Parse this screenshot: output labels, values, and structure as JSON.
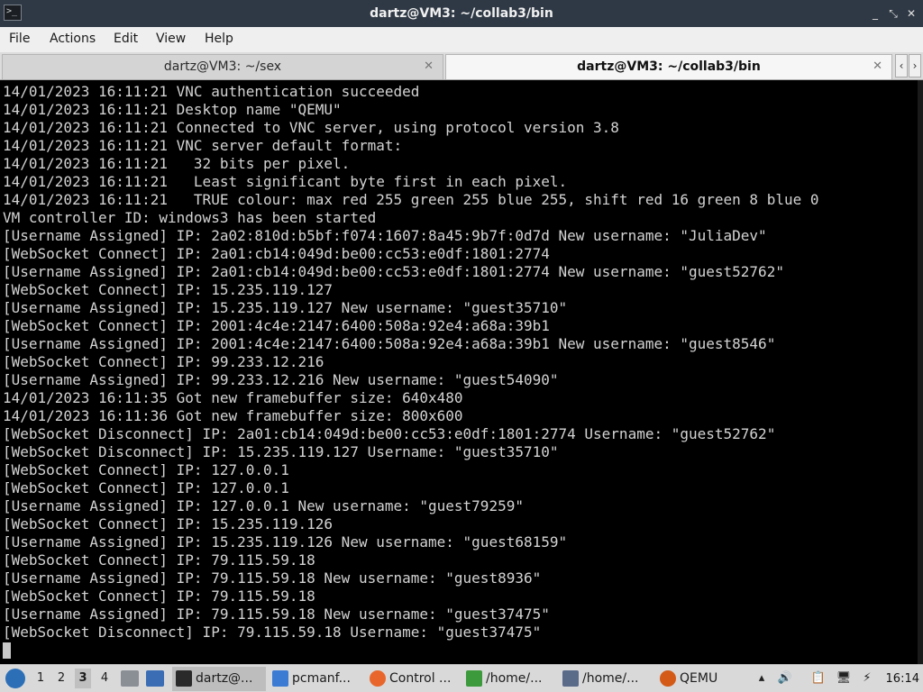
{
  "window": {
    "title": "dartz@VM3: ~/collab3/bin",
    "controls": {
      "minimize": "_",
      "maximize": "⤡",
      "close": "✕"
    }
  },
  "menu": [
    "File",
    "Actions",
    "Edit",
    "View",
    "Help"
  ],
  "tabs": [
    {
      "label": "dartz@VM3: ~/sex",
      "active": false
    },
    {
      "label": "dartz@VM3: ~/collab3/bin",
      "active": true
    }
  ],
  "tab_nav": {
    "left": "‹",
    "right": "›"
  },
  "terminal": {
    "lines": [
      "14/01/2023 16:11:21 VNC authentication succeeded",
      "14/01/2023 16:11:21 Desktop name \"QEMU\"",
      "14/01/2023 16:11:21 Connected to VNC server, using protocol version 3.8",
      "14/01/2023 16:11:21 VNC server default format:",
      "14/01/2023 16:11:21   32 bits per pixel.",
      "14/01/2023 16:11:21   Least significant byte first in each pixel.",
      "14/01/2023 16:11:21   TRUE colour: max red 255 green 255 blue 255, shift red 16 green 8 blue 0",
      "VM controller ID: windows3 has been started",
      "[Username Assigned] IP: 2a02:810d:b5bf:f074:1607:8a45:9b7f:0d7d New username: \"JuliaDev\"",
      "[WebSocket Connect] IP: 2a01:cb14:049d:be00:cc53:e0df:1801:2774",
      "[Username Assigned] IP: 2a01:cb14:049d:be00:cc53:e0df:1801:2774 New username: \"guest52762\"",
      "[WebSocket Connect] IP: 15.235.119.127",
      "[Username Assigned] IP: 15.235.119.127 New username: \"guest35710\"",
      "[WebSocket Connect] IP: 2001:4c4e:2147:6400:508a:92e4:a68a:39b1",
      "[Username Assigned] IP: 2001:4c4e:2147:6400:508a:92e4:a68a:39b1 New username: \"guest8546\"",
      "[WebSocket Connect] IP: 99.233.12.216",
      "[Username Assigned] IP: 99.233.12.216 New username: \"guest54090\"",
      "14/01/2023 16:11:35 Got new framebuffer size: 640x480",
      "14/01/2023 16:11:36 Got new framebuffer size: 800x600",
      "[WebSocket Disconnect] IP: 2a01:cb14:049d:be00:cc53:e0df:1801:2774 Username: \"guest52762\"",
      "[WebSocket Disconnect] IP: 15.235.119.127 Username: \"guest35710\"",
      "[WebSocket Connect] IP: 127.0.0.1",
      "[WebSocket Connect] IP: 127.0.0.1",
      "[Username Assigned] IP: 127.0.0.1 New username: \"guest79259\"",
      "[WebSocket Connect] IP: 15.235.119.126",
      "[Username Assigned] IP: 15.235.119.126 New username: \"guest68159\"",
      "[WebSocket Connect] IP: 79.115.59.18",
      "[Username Assigned] IP: 79.115.59.18 New username: \"guest8936\"",
      "[WebSocket Connect] IP: 79.115.59.18",
      "[Username Assigned] IP: 79.115.59.18 New username: \"guest37475\"",
      "[WebSocket Disconnect] IP: 79.115.59.18 Username: \"guest37475\""
    ]
  },
  "taskbar": {
    "workspaces": [
      "1",
      "2",
      "3",
      "4"
    ],
    "active_workspace": "3",
    "tasks": [
      {
        "label": "dartz@...",
        "icon": "terminal-icon",
        "active": true
      },
      {
        "label": "pcmanf...",
        "icon": "folder-icon",
        "active": false
      },
      {
        "label": "Control ...",
        "icon": "firefox-icon",
        "active": false
      },
      {
        "label": "/home/...",
        "icon": "editor-icon",
        "active": false
      },
      {
        "label": "/home/...",
        "icon": "image-viewer-icon",
        "active": false
      },
      {
        "label": "QEMU",
        "icon": "qemu-icon",
        "active": false
      }
    ],
    "clock": "16:14"
  }
}
